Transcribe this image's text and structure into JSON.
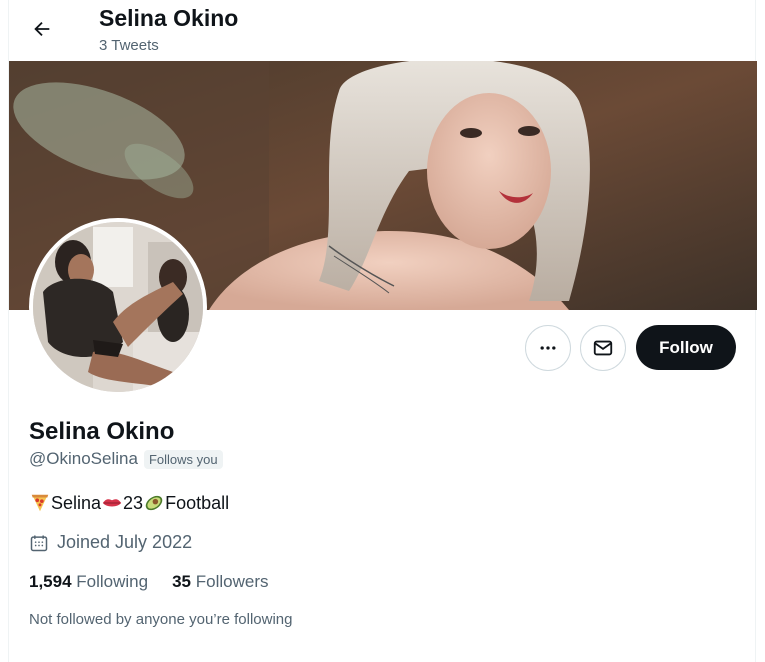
{
  "header": {
    "title": "Selina Okino",
    "subtitle": "3 Tweets",
    "back_icon": "arrow-left-icon"
  },
  "actions": {
    "more_icon": "more-horizontal-icon",
    "message_icon": "envelope-icon",
    "follow_label": "Follow"
  },
  "profile": {
    "name": "Selina Okino",
    "handle": "@OkinoSelina",
    "follows_you_badge": "Follows you",
    "bio": {
      "part1": "Selina",
      "part2": "23",
      "part3": "Football",
      "emoji_icons": [
        "pizza-icon",
        "lips-icon",
        "avocado-icon"
      ]
    },
    "joined": "Joined July 2022",
    "joined_icon": "calendar-icon",
    "following_count": "1,594",
    "following_label": "Following",
    "followers_count": "35",
    "followers_label": "Followers",
    "not_followed_text": "Not followed by anyone you’re following"
  },
  "colors": {
    "text_primary": "#0f1419",
    "text_secondary": "#536471",
    "follow_bg": "#0f1419",
    "border": "#cfd9de"
  }
}
